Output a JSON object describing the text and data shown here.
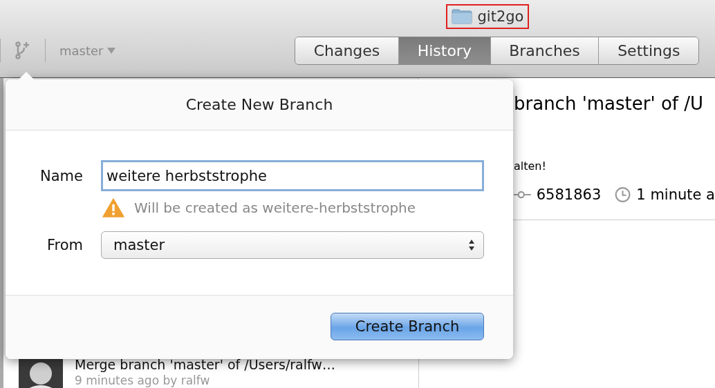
{
  "window": {
    "title": "git2go",
    "title_highlighted": true
  },
  "toolbar": {
    "branch": "master",
    "tabs": [
      {
        "label": "Changes",
        "selected": false
      },
      {
        "label": "History",
        "selected": true
      },
      {
        "label": "Branches",
        "selected": false
      },
      {
        "label": "Settings",
        "selected": false
      }
    ]
  },
  "commit_detail": {
    "title": "branch 'master' of /U",
    "message": "alten!",
    "sha": "6581863",
    "time": "1 minute a"
  },
  "history": [
    {
      "title": "Merge branch 'master' of /Users/ralfw…",
      "subtitle": "9 minutes ago by ralfw"
    }
  ],
  "popover": {
    "title": "Create New Branch",
    "name_label": "Name",
    "name_value": "weitere herbststrophe",
    "warning": "Will be created as weitere-herbststrophe",
    "from_label": "From",
    "from_value": "master",
    "button": "Create Branch"
  }
}
